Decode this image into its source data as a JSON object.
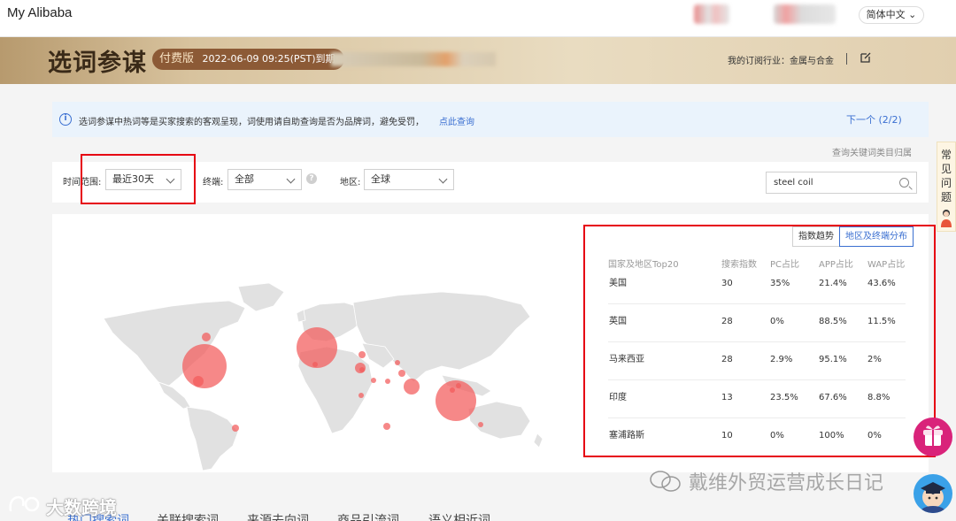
{
  "header": {
    "brand": "My Alibaba",
    "language": "简体中文 ⌄"
  },
  "banner": {
    "title": "选词参谋",
    "badge_label": "付费版",
    "badge_expiry": "2022-06-09 09:25(PST)到期",
    "industry": "我的订阅行业：金属与合金"
  },
  "notice": {
    "text": "选词参谋中热词等是买家搜索的客观呈现，词使用请自助查询是否为品牌词，避免受罚，",
    "link": "点此查询",
    "next": "下一个 (2/2)"
  },
  "category_link": "查询关键词类目归属",
  "filters": {
    "time_label": "时间范围:",
    "time_value": "最近30天",
    "terminal_label": "终端:",
    "terminal_value": "全部",
    "region_label": "地区:",
    "region_value": "全球",
    "search_value": "steel coil"
  },
  "view_tabs": [
    "指数趋势",
    "地区及终端分布"
  ],
  "table": {
    "headers": [
      "国家及地区Top20",
      "搜索指数",
      "PC占比",
      "APP占比",
      "WAP占比"
    ],
    "rows": [
      [
        "美国",
        "30",
        "35%",
        "21.4%",
        "43.6%"
      ],
      [
        "英国",
        "28",
        "0%",
        "88.5%",
        "11.5%"
      ],
      [
        "马来西亚",
        "28",
        "2.9%",
        "95.1%",
        "2%"
      ],
      [
        "印度",
        "13",
        "23.5%",
        "67.6%",
        "8.8%"
      ],
      [
        "塞浦路斯",
        "10",
        "0%",
        "100%",
        "0%"
      ]
    ]
  },
  "bottom_tabs": [
    "热门搜索词",
    "关联搜索词",
    "来源去向词",
    "商品引流词",
    "语义相近词"
  ],
  "faq": "常见问题",
  "watermarks": {
    "wechat": "戴维外贸运营成长日记",
    "dashu": "大数跨境"
  },
  "colors": {
    "accent": "#3a6fd1",
    "highlight_box": "#e60012",
    "bubble": "#f25a5a",
    "banner_badge": "#8c5a36"
  }
}
